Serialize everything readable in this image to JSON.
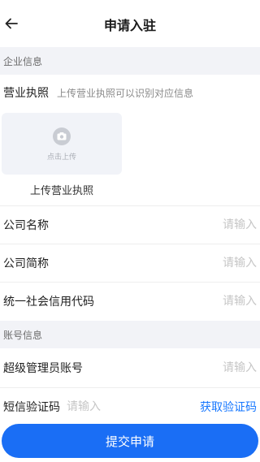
{
  "nav": {
    "title": "申请入驻",
    "back_icon": "arrow-left-icon"
  },
  "sections": {
    "company": "企业信息",
    "account": "账号信息"
  },
  "license": {
    "label": "营业执照",
    "hint": "上传营业执照可以识别对应信息",
    "upload_text": "点击上传",
    "caption": "上传营业执照",
    "upload_icon": "camera-icon"
  },
  "fields": {
    "company_name": {
      "label": "公司名称",
      "placeholder": "请输入"
    },
    "company_short": {
      "label": "公司简称",
      "placeholder": "请输入"
    },
    "credit_code": {
      "label": "统一社会信用代码",
      "placeholder": "请输入"
    },
    "admin_account": {
      "label": "超级管理员账号",
      "placeholder": "请输入"
    },
    "sms_code": {
      "label": "短信验证码",
      "placeholder": "请输入",
      "action": "获取验证码"
    }
  },
  "submit": {
    "label": "提交申请"
  },
  "colors": {
    "primary": "#1a6ef5",
    "link": "#1677ff",
    "section_bg": "#f2f3f7"
  }
}
